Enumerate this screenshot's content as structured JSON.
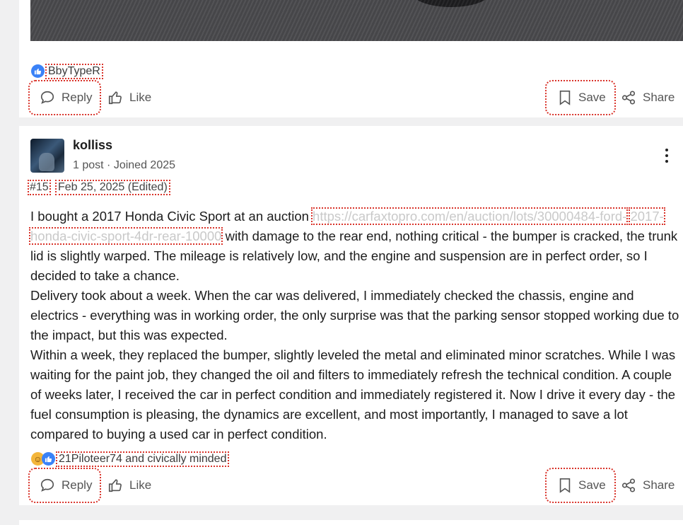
{
  "prev_post": {
    "reaction_names": "BbyTypeR",
    "actions": {
      "reply": "Reply",
      "like": "Like",
      "save": "Save",
      "share": "Share"
    }
  },
  "post": {
    "username": "kolliss",
    "post_count": "1 post",
    "separator": "·",
    "joined": "Joined 2025",
    "number": "#15",
    "date": "Feb 25, 2025 (Edited)",
    "line1_text": "I bought a 2017 Honda Civic Sport at an auction",
    "link_text_1": "https://carfaxtopro.com/en/auction/lots/30000484-ford-",
    "link_text_2": "2017-honda-civic-sport-4dr-rear-10000",
    "paragraphs": [
      "with damage to the rear end, nothing critical - the bumper is cracked, the trunk lid is slightly warped. The mileage is relatively low, and the engine and suspension are in perfect order, so I decided to take a chance.",
      "Delivery took about a week. When the car was delivered, I immediately checked the chassis, engine and electrics - everything was in working order, the only surprise was that the parking sensor stopped working due to the impact, but this was expected.",
      "Within a week, they replaced the bumper, slightly leveled the metal and eliminated minor scratches. While I was waiting for the paint job, they changed the oil and filters to immediately refresh the technical condition. A couple of weeks later, I received the car in perfect condition and immediately registered it. Now I drive it every day - the fuel consumption is pleasing, the dynamics are excellent, and most importantly, I managed to save a lot compared to buying a used car in perfect condition."
    ],
    "reaction_names": "21Piloteer74 and civically minded",
    "actions": {
      "reply": "Reply",
      "like": "Like",
      "save": "Save",
      "share": "Share"
    }
  },
  "icons": [
    "thumbs-up-icon",
    "laugh-emoji-icon",
    "speech-bubble-icon",
    "bookmark-icon",
    "share-icon",
    "more-vertical-icon"
  ],
  "colors": {
    "like_blue": "#3a82f7",
    "annotation_red": "#d9342b",
    "page_bg": "#f0f0f1"
  }
}
